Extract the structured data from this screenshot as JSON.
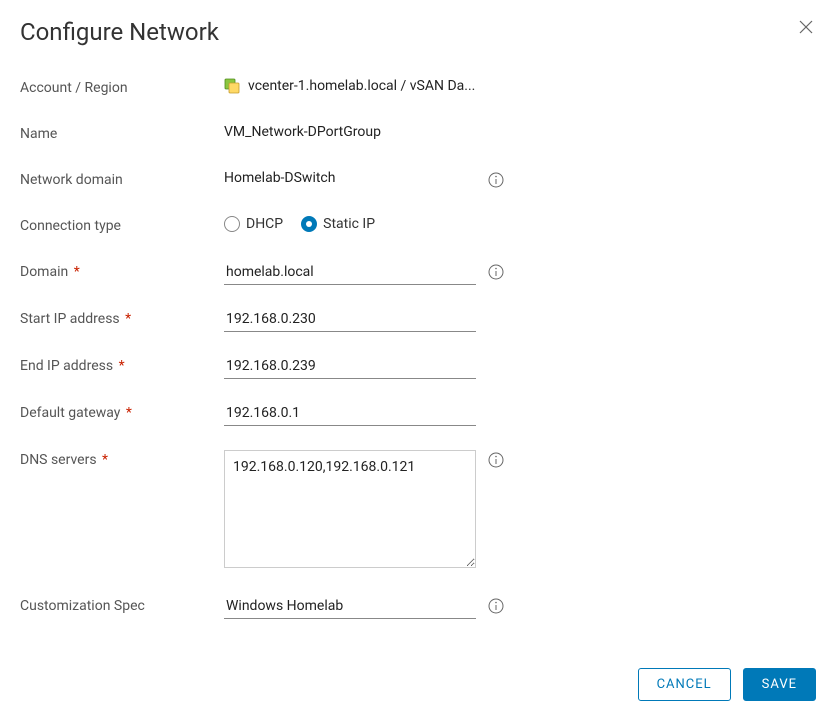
{
  "dialog": {
    "title": "Configure Network"
  },
  "labels": {
    "account_region": "Account / Region",
    "name": "Name",
    "network_domain": "Network domain",
    "connection_type": "Connection type",
    "domain": "Domain",
    "start_ip": "Start IP address",
    "end_ip": "End IP address",
    "default_gateway": "Default gateway",
    "dns_servers": "DNS servers",
    "customization_spec": "Customization Spec"
  },
  "values": {
    "account_region": "vcenter-1.homelab.local / vSAN Da...",
    "name": "VM_Network-DPortGroup",
    "network_domain": "Homelab-DSwitch",
    "domain": "homelab.local",
    "start_ip": "192.168.0.230",
    "end_ip": "192.168.0.239",
    "default_gateway": "192.168.0.1",
    "dns_servers": "192.168.0.120,192.168.0.121",
    "customization_spec": "Windows Homelab"
  },
  "connection_type": {
    "dhcp": "DHCP",
    "static_ip": "Static IP",
    "selected": "static_ip"
  },
  "buttons": {
    "cancel": "CANCEL",
    "save": "SAVE"
  },
  "required_mark": "*"
}
